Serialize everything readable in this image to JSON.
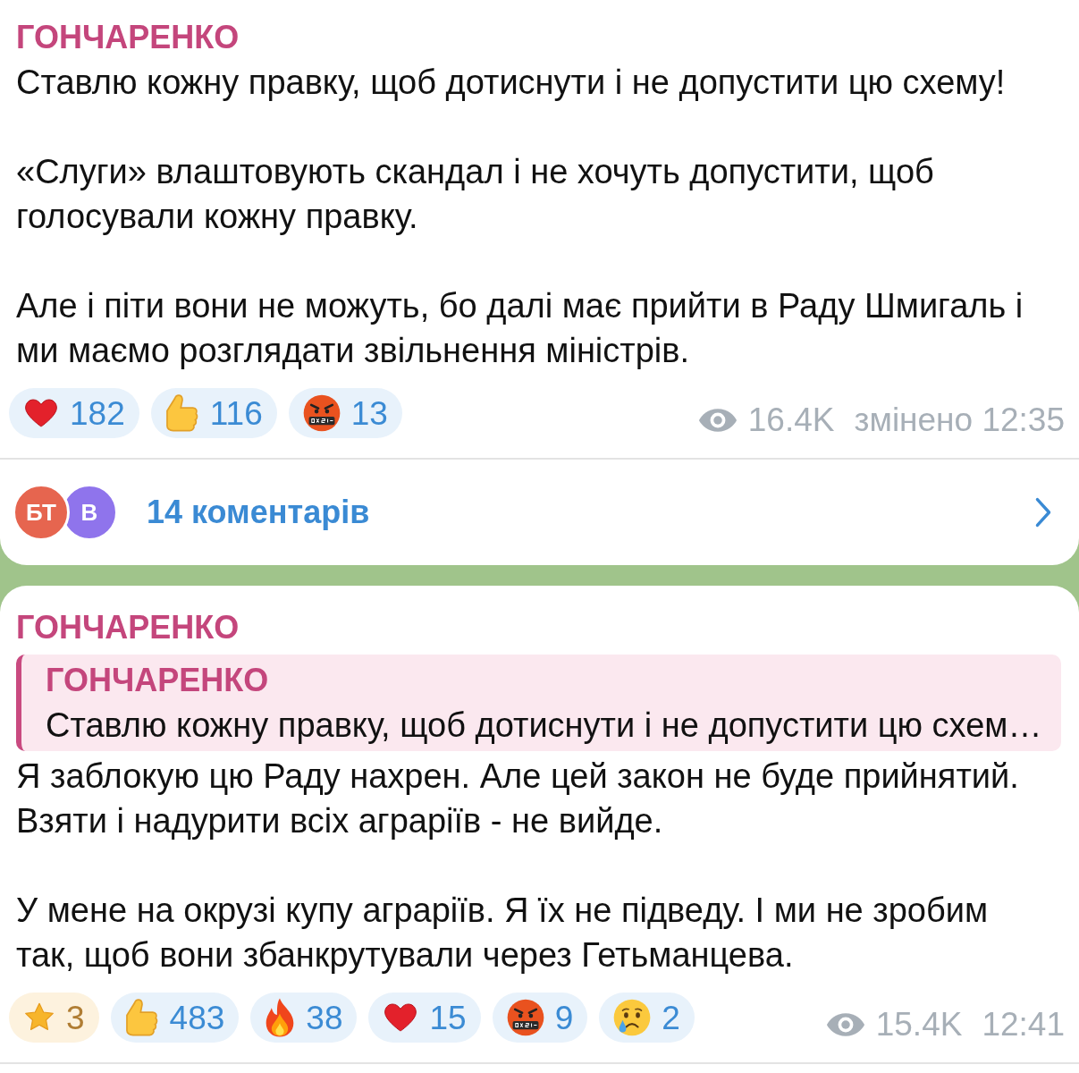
{
  "messages": [
    {
      "author": "ГОНЧАРЕНКО",
      "paragraphs": [
        "Ставлю кожну правку, щоб дотиснути і не допустити цю схему!",
        "«Слуги» влаштовують скандал і не хочуть допустити, щоб голосували кожну правку.",
        "Але і піти вони не можуть, бо далі має прийти в Раду Шмигаль і ми маємо розглядати звільнення міністрів."
      ],
      "reactions": [
        {
          "kind": "heart",
          "count": "182",
          "paid": false
        },
        {
          "kind": "thumbs_up",
          "count": "116",
          "paid": false
        },
        {
          "kind": "angry",
          "count": "13",
          "paid": false
        }
      ],
      "views": "16.4K",
      "time": "змінено 12:35",
      "comments": {
        "avatars": [
          {
            "initials": "БТ",
            "color": "#e6654f"
          },
          {
            "initials": "В",
            "color": "#8f74ec"
          }
        ],
        "label": "14 коментарів"
      }
    },
    {
      "author": "ГОНЧАРЕНКО",
      "reply": {
        "author": "ГОНЧАРЕНКО",
        "text": "Ставлю кожну правку, щоб дотиснути і не допустити цю схем…"
      },
      "paragraphs": [
        "Я заблокую цю Раду нахрен. Але цей закон не буде прийнятий. Взяти і надурити всіх аграріїв - не вийде.",
        "У мене на окрузі купу аграріїв. Я їх не підведу. І ми не зробим так, щоб вони збанкрутували через Гетьманцева."
      ],
      "reactions": [
        {
          "kind": "star",
          "count": "3",
          "paid": true
        },
        {
          "kind": "thumbs_up",
          "count": "483",
          "paid": false
        },
        {
          "kind": "fire",
          "count": "38",
          "paid": false
        },
        {
          "kind": "heart",
          "count": "15",
          "paid": false
        },
        {
          "kind": "angry",
          "count": "9",
          "paid": false
        },
        {
          "kind": "crying",
          "count": "2",
          "paid": false
        }
      ],
      "views": "15.4K",
      "time": "12:41"
    }
  ]
}
